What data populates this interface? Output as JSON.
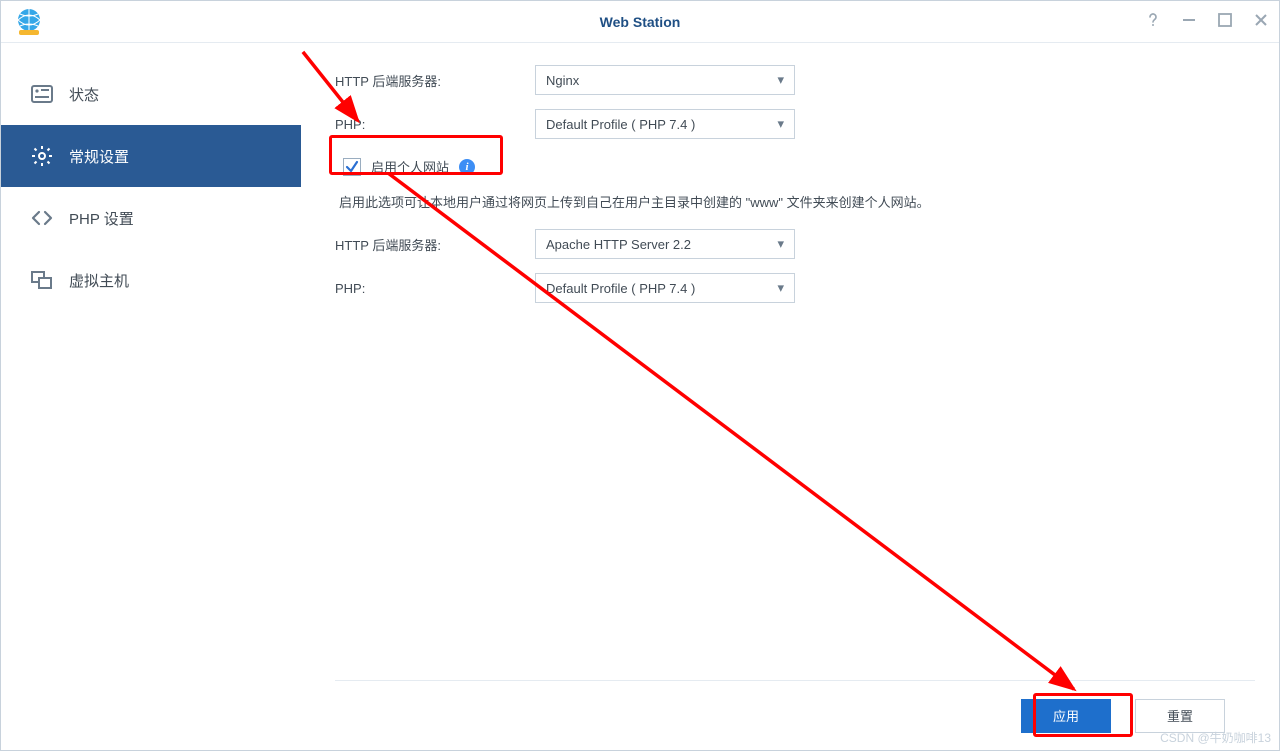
{
  "window": {
    "title": "Web Station"
  },
  "sidebar": {
    "items": [
      {
        "label": "状态"
      },
      {
        "label": "常规设置"
      },
      {
        "label": "PHP 设置"
      },
      {
        "label": "虚拟主机"
      }
    ]
  },
  "form": {
    "http_backend_label": "HTTP 后端服务器:",
    "http_backend_value": "Nginx",
    "php_label": "PHP:",
    "php_value": "Default Profile ( PHP 7.4 )",
    "enable_personal_label": "启用个人网站",
    "enable_personal_desc": "启用此选项可让本地用户通过将网页上传到自己在用户主目录中创建的 \"www\" 文件夹来创建个人网站。",
    "personal_http_backend_label": "HTTP 后端服务器:",
    "personal_http_backend_value": "Apache HTTP Server 2.2",
    "personal_php_label": "PHP:",
    "personal_php_value": "Default Profile ( PHP 7.4 )"
  },
  "footer": {
    "apply": "应用",
    "reset": "重置"
  },
  "watermark": "CSDN @牛奶咖啡13"
}
